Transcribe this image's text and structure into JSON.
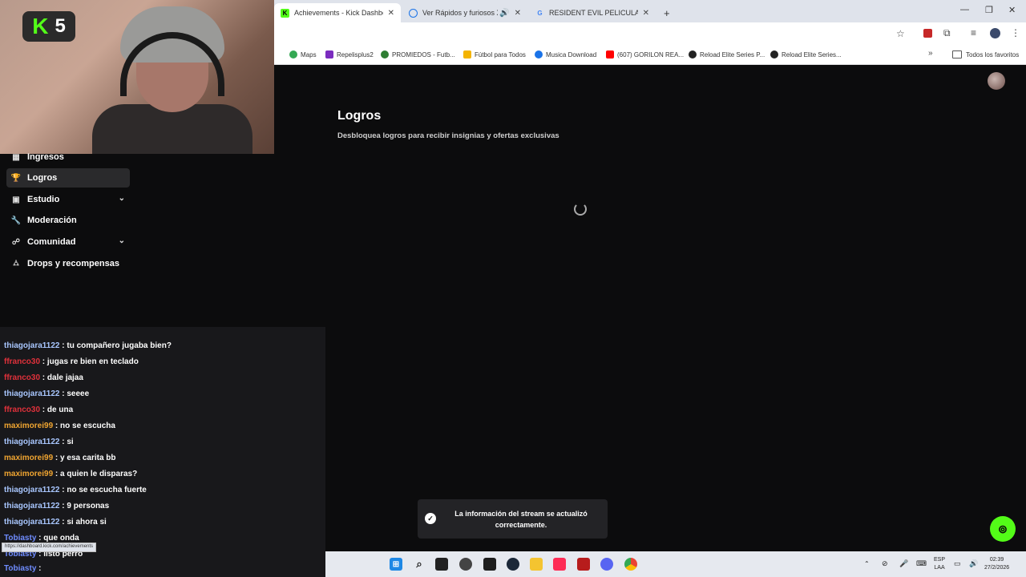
{
  "browser": {
    "tabs": [
      {
        "label": "Achievements - Kick Dashboard",
        "icon": "kick-icon",
        "active": true
      },
      {
        "label": "Ver Rápidos y furiosos X Or",
        "icon": "globe-icon",
        "active": false
      },
      {
        "label": "RESIDENT EVIL PELICULA SAGA",
        "icon": "google-icon",
        "active": false
      }
    ],
    "new_tab": "+",
    "bookmarks": [
      {
        "label": "Maps",
        "color": "#34a853"
      },
      {
        "label": "Repelisplus2",
        "color": "#7b2cbf"
      },
      {
        "label": "PROMIEDOS - Futb...",
        "color": "#2e7d32"
      },
      {
        "label": "Fútbol para Todos",
        "color": "#f4b400"
      },
      {
        "label": "Musica Download",
        "color": "#1a73e8"
      },
      {
        "label": "(607) GORILON REA...",
        "color": "#ff0000"
      },
      {
        "label": "Reload Elite Series P...",
        "color": "#222222"
      },
      {
        "label": "Reload Elite Series...",
        "color": "#222222"
      }
    ],
    "all_favorites": "Todos los favoritos"
  },
  "webcam": {
    "badge_letter": "K",
    "badge_number": "5"
  },
  "sidebar": {
    "items": [
      {
        "label": "Ingresos",
        "icon": "chart-icon"
      },
      {
        "label": "Logros",
        "icon": "trophy-icon",
        "active": true
      },
      {
        "label": "Estudio",
        "icon": "studio-icon",
        "chevron": true
      },
      {
        "label": "Moderación",
        "icon": "wrench-icon"
      },
      {
        "label": "Comunidad",
        "icon": "users-icon",
        "chevron": true
      },
      {
        "label": "Drops y recompensas",
        "icon": "gift-icon"
      }
    ]
  },
  "main": {
    "title": "Logros",
    "subtitle": "Desbloquea logros para recibir insignias y ofertas exclusivas"
  },
  "chat": {
    "lines": [
      {
        "user": "thiagojara1122",
        "msg": " : tu compañero jugaba bien?",
        "color": "#a9c7ff"
      },
      {
        "user": "ffranco30",
        "msg": " : jugas re bien en teclado",
        "color": "#e0313b"
      },
      {
        "user": "ffranco30",
        "msg": " : dale jajaa",
        "color": "#e0313b"
      },
      {
        "user": "thiagojara1122",
        "msg": " : seeee",
        "color": "#a9c7ff"
      },
      {
        "user": "ffranco30",
        "msg": " : de una",
        "color": "#e0313b"
      },
      {
        "user": "maximorei99",
        "msg": " : no se escucha",
        "color": "#f0a531"
      },
      {
        "user": "thiagojara1122",
        "msg": " : si",
        "color": "#a9c7ff"
      },
      {
        "user": "maximorei99",
        "msg": " : y esa carita bb",
        "color": "#f0a531"
      },
      {
        "user": "maximorei99",
        "msg": " : a quien le disparas?",
        "color": "#f0a531"
      },
      {
        "user": "thiagojara1122",
        "msg": " : no se escucha fuerte",
        "color": "#a9c7ff"
      },
      {
        "user": "thiagojara1122",
        "msg": " : 9 personas",
        "color": "#a9c7ff"
      },
      {
        "user": "thiagojara1122",
        "msg": " : si ahora si",
        "color": "#a9c7ff"
      },
      {
        "user": "Tobiasty",
        "msg": " : que onda",
        "color": "#6f8cff"
      },
      {
        "user": "Tobiasty",
        "msg": " : listo perro",
        "color": "#6f8cff"
      },
      {
        "user": "Tobiasty",
        "msg": " :",
        "color": "#6f8cff"
      }
    ],
    "status_url": "https://dashboard.kick.com/achievements"
  },
  "toast": {
    "message": "La información del stream se actualizó correctamente."
  },
  "taskbar": {
    "lang": "ESP",
    "lang_sub": "LAA",
    "time": "02:39",
    "date": "27/2/2026"
  }
}
